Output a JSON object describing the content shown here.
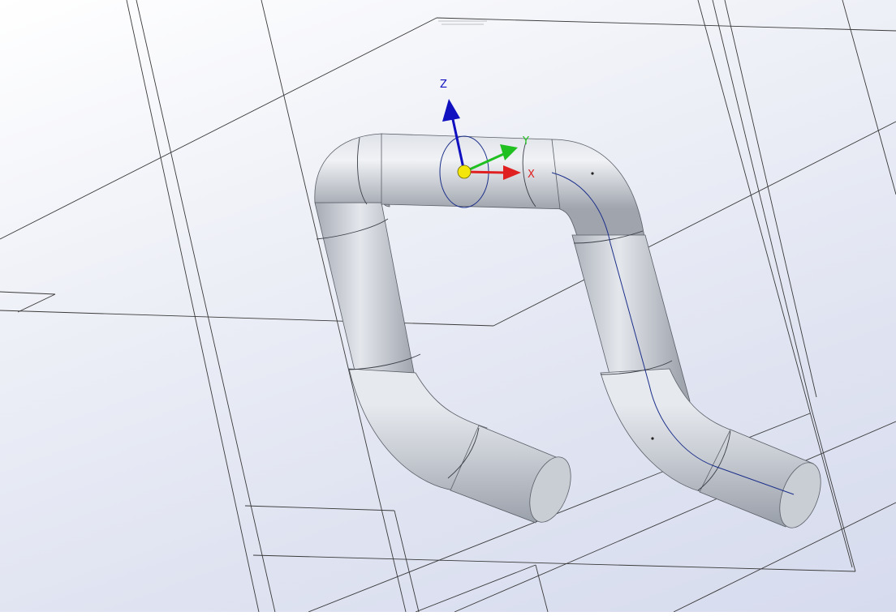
{
  "viewport": {
    "background_top": "#ffffff",
    "background_bottom": "#d6dbee"
  },
  "triad": {
    "x_label": "X",
    "y_label": "Y",
    "z_label": "Z",
    "x_color": "#e02020",
    "y_color": "#20c020",
    "z_color": "#1010c0",
    "origin_color": "#f2e60a"
  },
  "model": {
    "shape": "bent-pipe",
    "surface_color": "#c4c9d1"
  },
  "icons": {
    "triad": "coordinate-triad-icon",
    "origin": "origin-point-icon"
  }
}
